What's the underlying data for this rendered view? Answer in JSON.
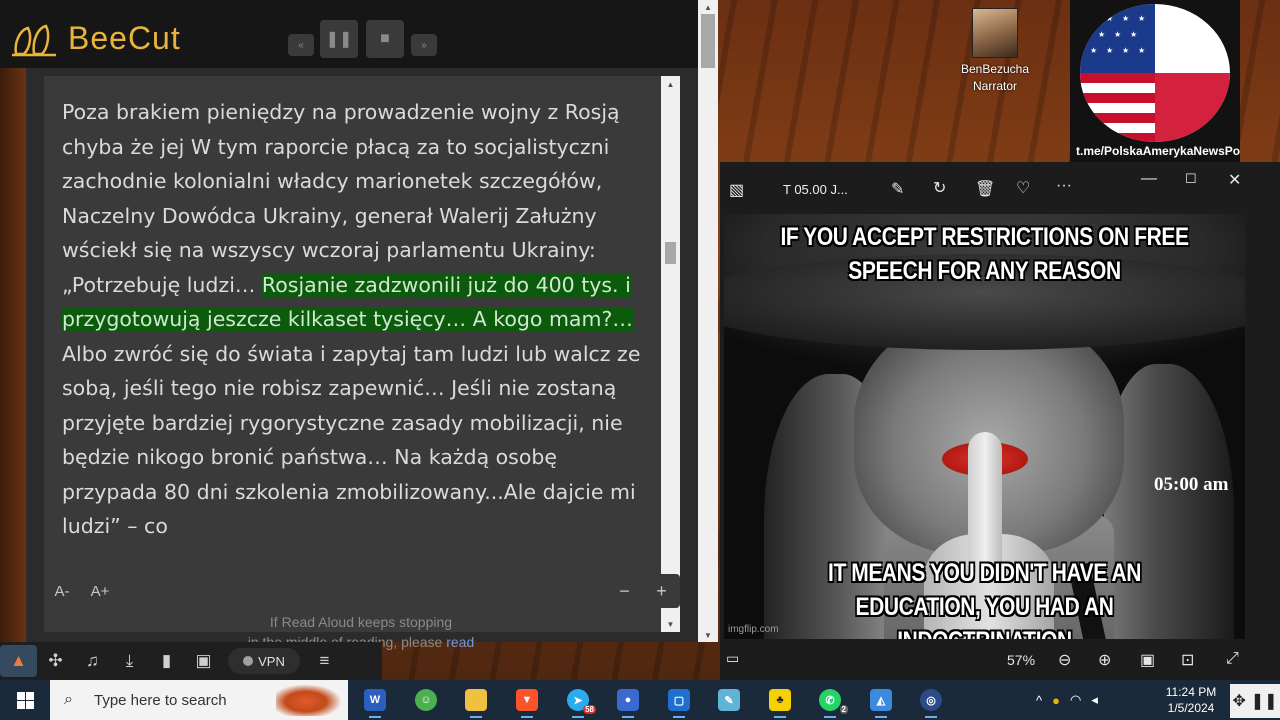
{
  "beecut": {
    "title": "BeeCut",
    "buttons": {
      "rewind": "«",
      "pause": "❚❚",
      "stop": "■",
      "forward": "»"
    }
  },
  "reader": {
    "text_before": "Poza brakiem pieniędzy na prowadzenie wojny z Rosją chyba że jej W tym raporcie płacą za to socjalistyczni zachodnie kolonialni władcy marionetek szczegółów, Naczelny Dowódca Ukrainy, generał Walerij Załużny wściekł się na wszyscy wczoraj parlamentu Ukrainy: „Potrzebuję ludzi… ",
    "text_highlight": "Rosjanie zadzwonili już do 400 tys. i przygotowują jeszcze kilkaset tysięcy… A kogo mam?…",
    "text_after": " Albo zwróć się do świata i zapytaj tam ludzi lub walcz ze sobą, jeśli tego nie robisz zapewnić… Jeśli nie zostaną przyjęte bardziej rygorystyczne zasady mobilizacji, nie będzie nikogo bronić państwa… Na każdą osobę przypada 80 dni szkolenia zmobilizowany...Ale dajcie mi ludzi” – co",
    "font_decrease": "A-",
    "font_increase": "A+",
    "zoom_minus": "−",
    "zoom_plus": "+",
    "help_text": "If Read Aloud keeps stopping",
    "help_text2": "in the middle of reading, please",
    "help_link": "read"
  },
  "browser_toolbar": {
    "vpn_label": "VPN",
    "menu_icon": "≡"
  },
  "telegram": {
    "narrator_name": "BenBezucha",
    "narrator_role": "Narrator",
    "channel_url": "t.me/PolskaAmerykaNewsPo"
  },
  "photos": {
    "title": "T 05.00 J...",
    "zoom_level": "57%",
    "meme_top": "If you accept restrictions on free speech for any reason",
    "meme_bottom": "It means you didn't have an education, you had an indoctrination",
    "clock_text": "05:00 am",
    "watermark": "imgflip.com"
  },
  "taskbar": {
    "search_placeholder": "Type here to search",
    "time": "11:24 PM",
    "date": "1/5/2024",
    "telegram_badge": "58",
    "whatsapp_badge": "2"
  },
  "colors": {
    "beecut_accent": "#e8b53a",
    "highlight_bg": "#0c5a0c",
    "taskbar_bg": "#1b2a3a"
  }
}
